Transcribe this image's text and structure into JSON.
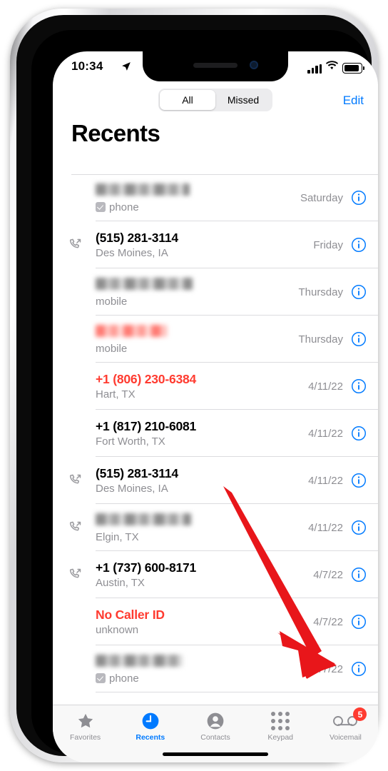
{
  "status_bar": {
    "time": "10:34",
    "location_icon": "location-arrow-icon",
    "signal_icon": "cellular-signal-icon",
    "wifi_icon": "wifi-icon",
    "battery_icon": "battery-icon"
  },
  "header": {
    "segments": [
      {
        "label": "All",
        "selected": true
      },
      {
        "label": "Missed",
        "selected": false
      }
    ],
    "edit_label": "Edit",
    "title": "Recents"
  },
  "colors": {
    "accent_blue": "#007aff",
    "missed_red": "#ff3b30",
    "secondary_gray": "#8e8e93",
    "annotation_red": "#e8161a"
  },
  "calls": [
    {
      "name": "",
      "redacted": true,
      "redacted_tone": "gray",
      "redacted_width": 132,
      "subtitle": "phone",
      "has_checkbox": true,
      "date": "Saturday",
      "direction": "",
      "missed": false
    },
    {
      "name": "(515) 281-3114",
      "redacted": false,
      "subtitle": "Des Moines, IA",
      "has_checkbox": false,
      "date": "Friday",
      "direction": "outgoing",
      "missed": false
    },
    {
      "name": "",
      "redacted": true,
      "redacted_tone": "gray",
      "redacted_width": 136,
      "subtitle": "mobile",
      "has_checkbox": false,
      "date": "Thursday",
      "direction": "",
      "missed": false
    },
    {
      "name": "",
      "redacted": true,
      "redacted_tone": "red",
      "redacted_width": 100,
      "subtitle": "mobile",
      "has_checkbox": false,
      "date": "Thursday",
      "direction": "",
      "missed": true
    },
    {
      "name": "+1 (806) 230-6384",
      "redacted": false,
      "subtitle": "Hart, TX",
      "has_checkbox": false,
      "date": "4/11/22",
      "direction": "",
      "missed": true
    },
    {
      "name": "+1 (817) 210-6081",
      "redacted": false,
      "subtitle": "Fort Worth, TX",
      "has_checkbox": false,
      "date": "4/11/22",
      "direction": "",
      "missed": false
    },
    {
      "name": "(515) 281-3114",
      "redacted": false,
      "subtitle": "Des Moines, IA",
      "has_checkbox": false,
      "date": "4/11/22",
      "direction": "outgoing",
      "missed": false
    },
    {
      "name": "",
      "redacted": true,
      "redacted_tone": "gray",
      "redacted_width": 134,
      "subtitle": "Elgin, TX",
      "has_checkbox": false,
      "date": "4/11/22",
      "direction": "outgoing",
      "missed": false
    },
    {
      "name": "+1 (737) 600-8171",
      "redacted": false,
      "subtitle": "Austin, TX",
      "has_checkbox": false,
      "date": "4/7/22",
      "direction": "outgoing",
      "missed": false
    },
    {
      "name": "No Caller ID",
      "redacted": false,
      "subtitle": "unknown",
      "has_checkbox": false,
      "date": "4/7/22",
      "direction": "",
      "missed": true
    },
    {
      "name": "",
      "redacted": true,
      "redacted_tone": "gray",
      "redacted_width": 122,
      "subtitle": "phone",
      "has_checkbox": true,
      "date": "4/7/22",
      "direction": "",
      "missed": false
    }
  ],
  "info_button_label": "i",
  "tab_bar": {
    "tabs": [
      {
        "label": "Favorites",
        "icon": "star-icon",
        "active": false,
        "badge": ""
      },
      {
        "label": "Recents",
        "icon": "clock-icon",
        "active": true,
        "badge": ""
      },
      {
        "label": "Contacts",
        "icon": "person-icon",
        "active": false,
        "badge": ""
      },
      {
        "label": "Keypad",
        "icon": "keypad-icon",
        "active": false,
        "badge": ""
      },
      {
        "label": "Voicemail",
        "icon": "voicemail-icon",
        "active": false,
        "badge": "5"
      }
    ]
  },
  "annotation": {
    "type": "arrow",
    "points_to": "voicemail-tab",
    "color": "#e8161a"
  }
}
